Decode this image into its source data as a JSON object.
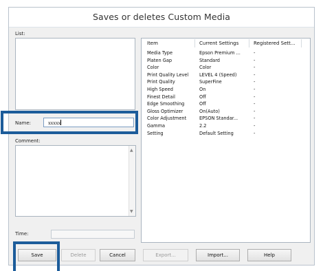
{
  "dialog": {
    "title": "Saves or deletes Custom Media"
  },
  "left": {
    "list_label": "List:",
    "name_label": "Name:",
    "name_value": "xxxxx",
    "comment_label": "Comment:",
    "time_label": "Time:"
  },
  "grid": {
    "headers": [
      "Item",
      "Current Settings",
      "Registered Sett..."
    ],
    "rows": [
      [
        "Media Type",
        "Epson Premium ...",
        "-"
      ],
      [
        "Platen Gap",
        "Standard",
        "-"
      ],
      [
        "Color",
        "Color",
        "-"
      ],
      [
        "Print Quality Level",
        "LEVEL 4 (Speed)",
        "-"
      ],
      [
        "Print Quality",
        "SuperFine",
        "-"
      ],
      [
        "High Speed",
        "On",
        "-"
      ],
      [
        "Finest Detail",
        "Off",
        "-"
      ],
      [
        "Edge Smoothing",
        "Off",
        "-"
      ],
      [
        "Gloss Optimizer",
        "On(Auto)",
        "-"
      ],
      [
        "Color Adjustment",
        "EPSON Standar...",
        "-"
      ],
      [
        "Gamma",
        "2.2",
        "-"
      ],
      [
        "Setting",
        "Default Setting",
        "-"
      ]
    ]
  },
  "buttons": {
    "save": "Save",
    "delete": "Delete",
    "cancel": "Cancel",
    "export": "Export...",
    "import": "Import...",
    "help": "Help"
  },
  "colors": {
    "highlight": "#1c5c9a"
  }
}
